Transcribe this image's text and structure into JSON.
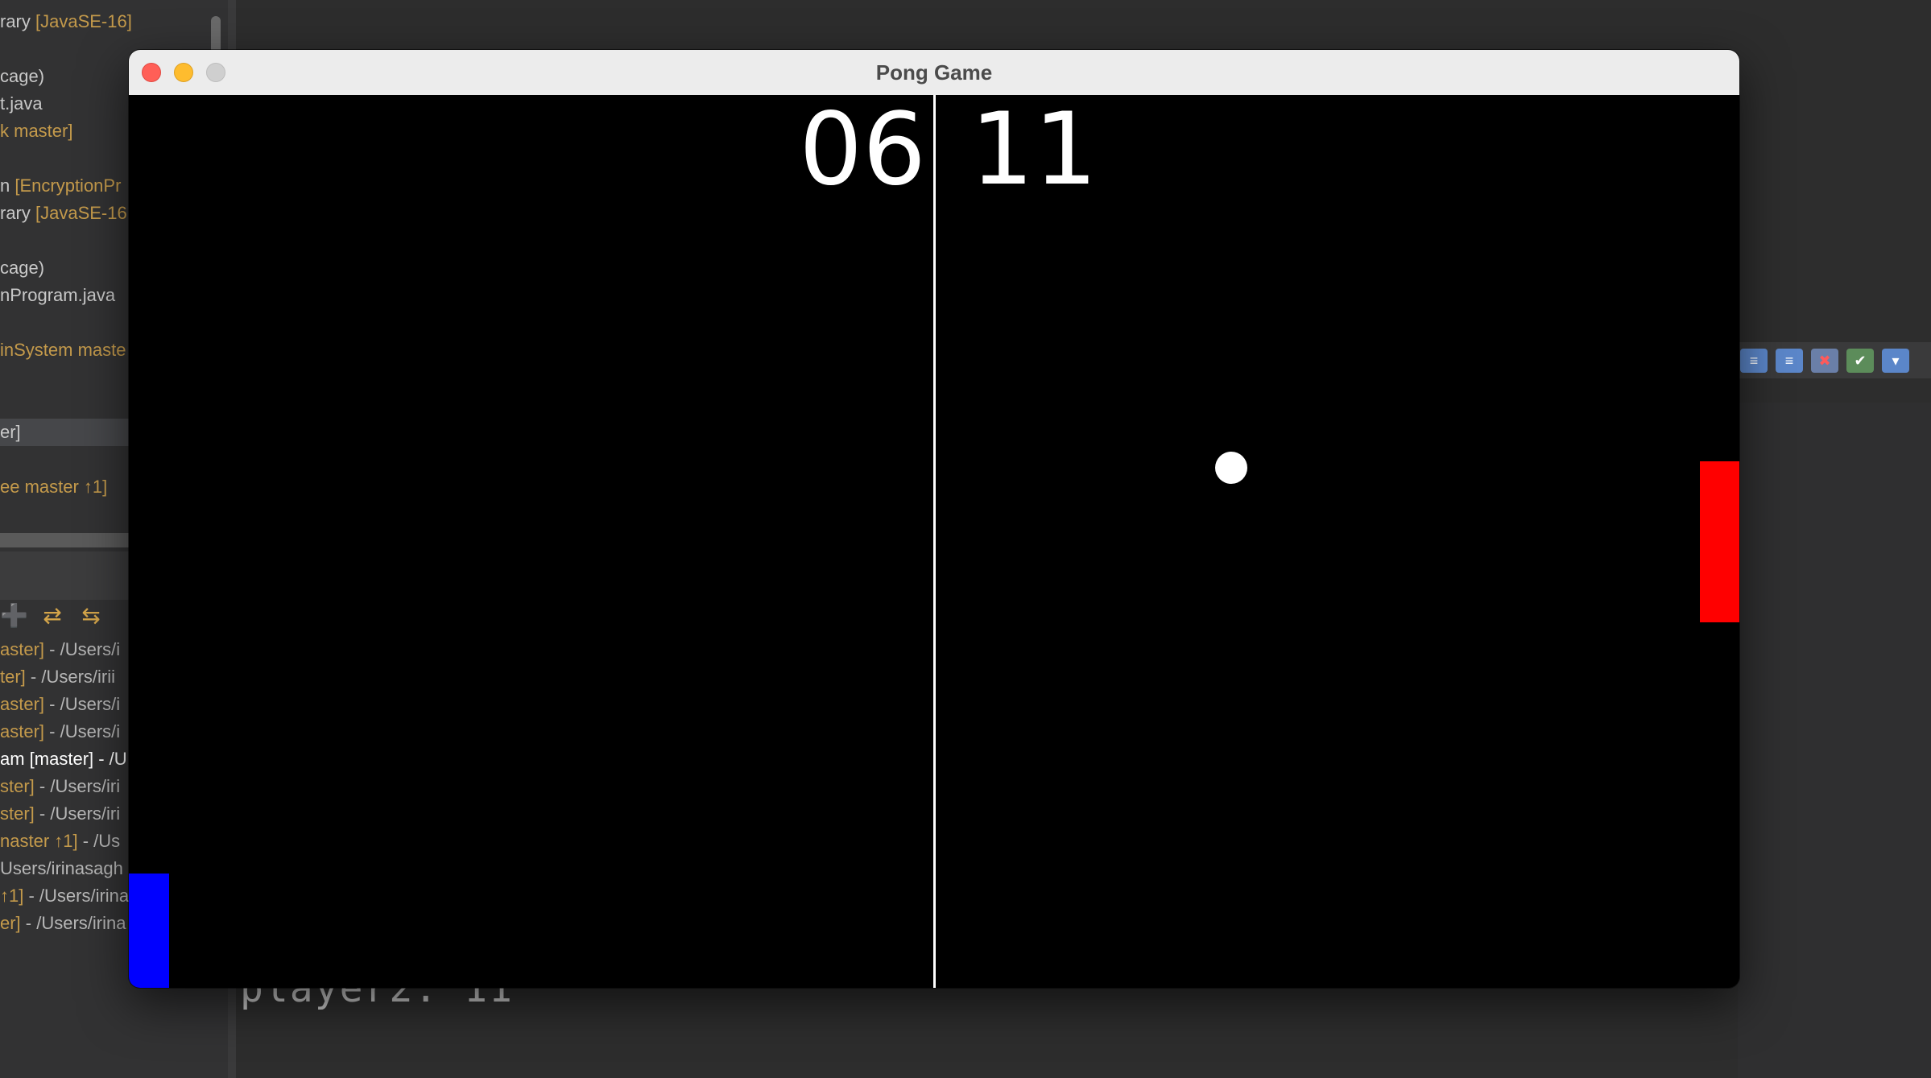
{
  "ide": {
    "explorer_lines": [
      {
        "a": "rary ",
        "b": "[JavaSE-16]"
      },
      {
        "a": "",
        "b": ""
      },
      {
        "a": "cage)",
        "b": ""
      },
      {
        "a": "t.java",
        "b": ""
      },
      {
        "a": "",
        "b": "k master]"
      },
      {
        "a": "",
        "b": ""
      },
      {
        "a": "n ",
        "b": "[EncryptionPr"
      },
      {
        "a": "rary ",
        "b": "[JavaSE-16"
      },
      {
        "a": "",
        "b": ""
      },
      {
        "a": "cage)",
        "b": ""
      },
      {
        "a": "nProgram.java",
        "b": ""
      },
      {
        "a": "",
        "b": ""
      },
      {
        "a": "",
        "b": "inSystem maste"
      },
      {
        "a": "",
        "b": ""
      },
      {
        "a": "",
        "b": ""
      },
      {
        "a": "er]",
        "b": ""
      },
      {
        "a": "",
        "b": ""
      },
      {
        "a": "",
        "b": "ee master ↑1]"
      }
    ],
    "repo_lines": [
      {
        "a": "aster]",
        "b": " - /Users/i"
      },
      {
        "a": "ter]",
        "b": " - /Users/irii"
      },
      {
        "a": "aster]",
        "b": " - /Users/i"
      },
      {
        "a": "aster]",
        "b": " - /Users/i"
      },
      {
        "a": "am [master] - /U",
        "b": ""
      },
      {
        "a": "ster]",
        "b": " - /Users/iri"
      },
      {
        "a": "ster]",
        "b": " - /Users/iri"
      },
      {
        "a": "naster ↑1]",
        "b": " - /Us"
      },
      {
        "a": "",
        "b": "Users/irinasagh"
      },
      {
        "a": "↑1]",
        "b": " - /Users/irina"
      },
      {
        "a": "er]",
        "b": " - /Users/irina"
      }
    ],
    "console_text": "player2: 11"
  },
  "window": {
    "title": "Pong Game"
  },
  "game": {
    "player1_score": "06",
    "player2_score": "11",
    "colors": {
      "player1_paddle": "#0000ff",
      "player2_paddle": "#ff0000",
      "ball": "#ffffff",
      "court": "#000000"
    }
  }
}
